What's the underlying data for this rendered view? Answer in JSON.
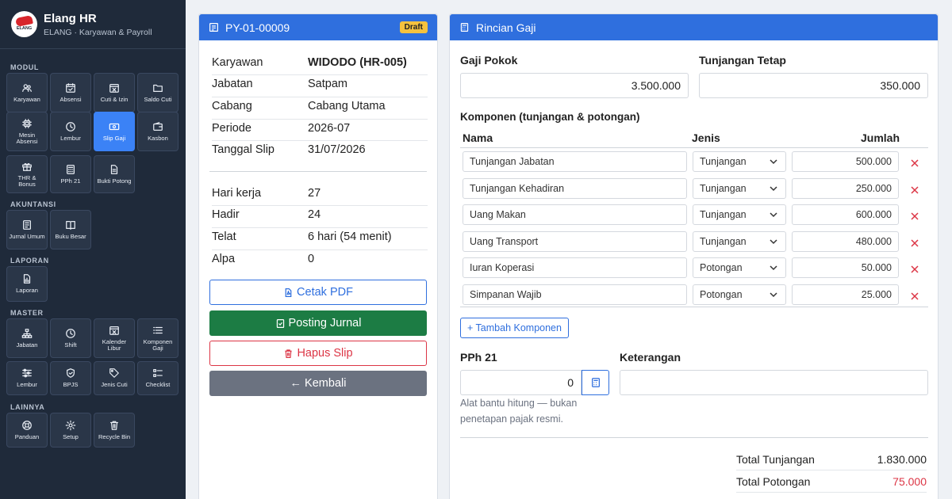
{
  "app": {
    "title": "Elang HR",
    "subtitle": "ELANG · Karyawan & Payroll",
    "logo_text": "ELANG"
  },
  "sidebar": {
    "sections": [
      {
        "title": "MODUL",
        "items": [
          {
            "label": "Karyawan",
            "icon": "users-icon"
          },
          {
            "label": "Absensi",
            "icon": "calendar-check-icon"
          },
          {
            "label": "Cuti & Izin",
            "icon": "calendar-x-icon"
          },
          {
            "label": "Saldo Cuti",
            "icon": "folder-icon"
          },
          {
            "label": "Mesin Absensi",
            "icon": "cpu-icon"
          },
          {
            "label": "Lembur",
            "icon": "clock-icon"
          },
          {
            "label": "Slip Gaji",
            "icon": "cash-icon",
            "active": true
          },
          {
            "label": "Kasbon",
            "icon": "wallet-icon"
          },
          {
            "label": "THR & Bonus",
            "icon": "gift-icon"
          },
          {
            "label": "PPh 21",
            "icon": "calculator-icon"
          },
          {
            "label": "Bukti Potong",
            "icon": "file-icon"
          }
        ]
      },
      {
        "title": "AKUNTANSI",
        "items": [
          {
            "label": "Jurnal Umum",
            "icon": "journal-icon"
          },
          {
            "label": "Buku Besar",
            "icon": "book-icon"
          }
        ]
      },
      {
        "title": "LAPORAN",
        "items": [
          {
            "label": "Laporan",
            "icon": "report-icon"
          }
        ]
      },
      {
        "title": "MASTER",
        "items": [
          {
            "label": "Jabatan",
            "icon": "org-chart-icon"
          },
          {
            "label": "Shift",
            "icon": "clock-icon"
          },
          {
            "label": "Kalender Libur",
            "icon": "calendar-x-icon"
          },
          {
            "label": "Komponen Gaji",
            "icon": "list-icon"
          },
          {
            "label": "Lembur",
            "icon": "sliders-icon"
          },
          {
            "label": "BPJS",
            "icon": "shield-icon"
          },
          {
            "label": "Jenis Cuti",
            "icon": "tag-icon"
          },
          {
            "label": "Checklist",
            "icon": "checklist-icon"
          }
        ]
      },
      {
        "title": "LAINNYA",
        "items": [
          {
            "label": "Panduan",
            "icon": "lifebuoy-icon"
          },
          {
            "label": "Setup",
            "icon": "gear-icon"
          },
          {
            "label": "Recycle Bin",
            "icon": "trash-icon"
          }
        ]
      }
    ]
  },
  "slip": {
    "code": "PY-01-00009",
    "status": "Draft",
    "info": [
      {
        "label": "Karyawan",
        "value": "WIDODO (HR-005)"
      },
      {
        "label": "Jabatan",
        "value": "Satpam"
      },
      {
        "label": "Cabang",
        "value": "Cabang Utama"
      },
      {
        "label": "Periode",
        "value": "2026-07"
      },
      {
        "label": "Tanggal Slip",
        "value": "31/07/2026"
      }
    ],
    "attendance": [
      {
        "label": "Hari kerja",
        "value": "27"
      },
      {
        "label": "Hadir",
        "value": "24"
      },
      {
        "label": "Telat",
        "value": "6 hari (54 menit)"
      },
      {
        "label": "Alpa",
        "value": "0"
      }
    ],
    "buttons": {
      "pdf": "Cetak PDF",
      "post": "Posting Jurnal",
      "delete": "Hapus Slip",
      "back": "← Kembali"
    }
  },
  "detail": {
    "title": "Rincian Gaji",
    "gaji_pokok": {
      "label": "Gaji Pokok",
      "value": "3.500.000"
    },
    "tunjangan_tetap": {
      "label": "Tunjangan Tetap",
      "value": "350.000"
    },
    "komponen_title": "Komponen (tunjangan & potongan)",
    "columns": {
      "nama": "Nama",
      "jenis": "Jenis",
      "jumlah": "Jumlah"
    },
    "components": [
      {
        "nama": "Tunjangan Jabatan",
        "jenis": "Tunjangan",
        "jumlah": "500.000"
      },
      {
        "nama": "Tunjangan Kehadiran",
        "jenis": "Tunjangan",
        "jumlah": "250.000"
      },
      {
        "nama": "Uang Makan",
        "jenis": "Tunjangan",
        "jumlah": "600.000"
      },
      {
        "nama": "Uang Transport",
        "jenis": "Tunjangan",
        "jumlah": "480.000"
      },
      {
        "nama": "Iuran Koperasi",
        "jenis": "Potongan",
        "jumlah": "50.000"
      },
      {
        "nama": "Simpanan Wajib",
        "jenis": "Potongan",
        "jumlah": "25.000"
      }
    ],
    "add_label": "+ Tambah Komponen",
    "pph": {
      "label": "PPh 21",
      "value": "0",
      "help": "Alat bantu hitung — bukan penetapan pajak resmi."
    },
    "keterangan": {
      "label": "Keterangan",
      "value": ""
    },
    "totals": [
      {
        "label": "Total Tunjangan",
        "value": "1.830.000"
      },
      {
        "label": "Total Potongan",
        "value": "75.000",
        "color": "#dc3545"
      }
    ]
  }
}
